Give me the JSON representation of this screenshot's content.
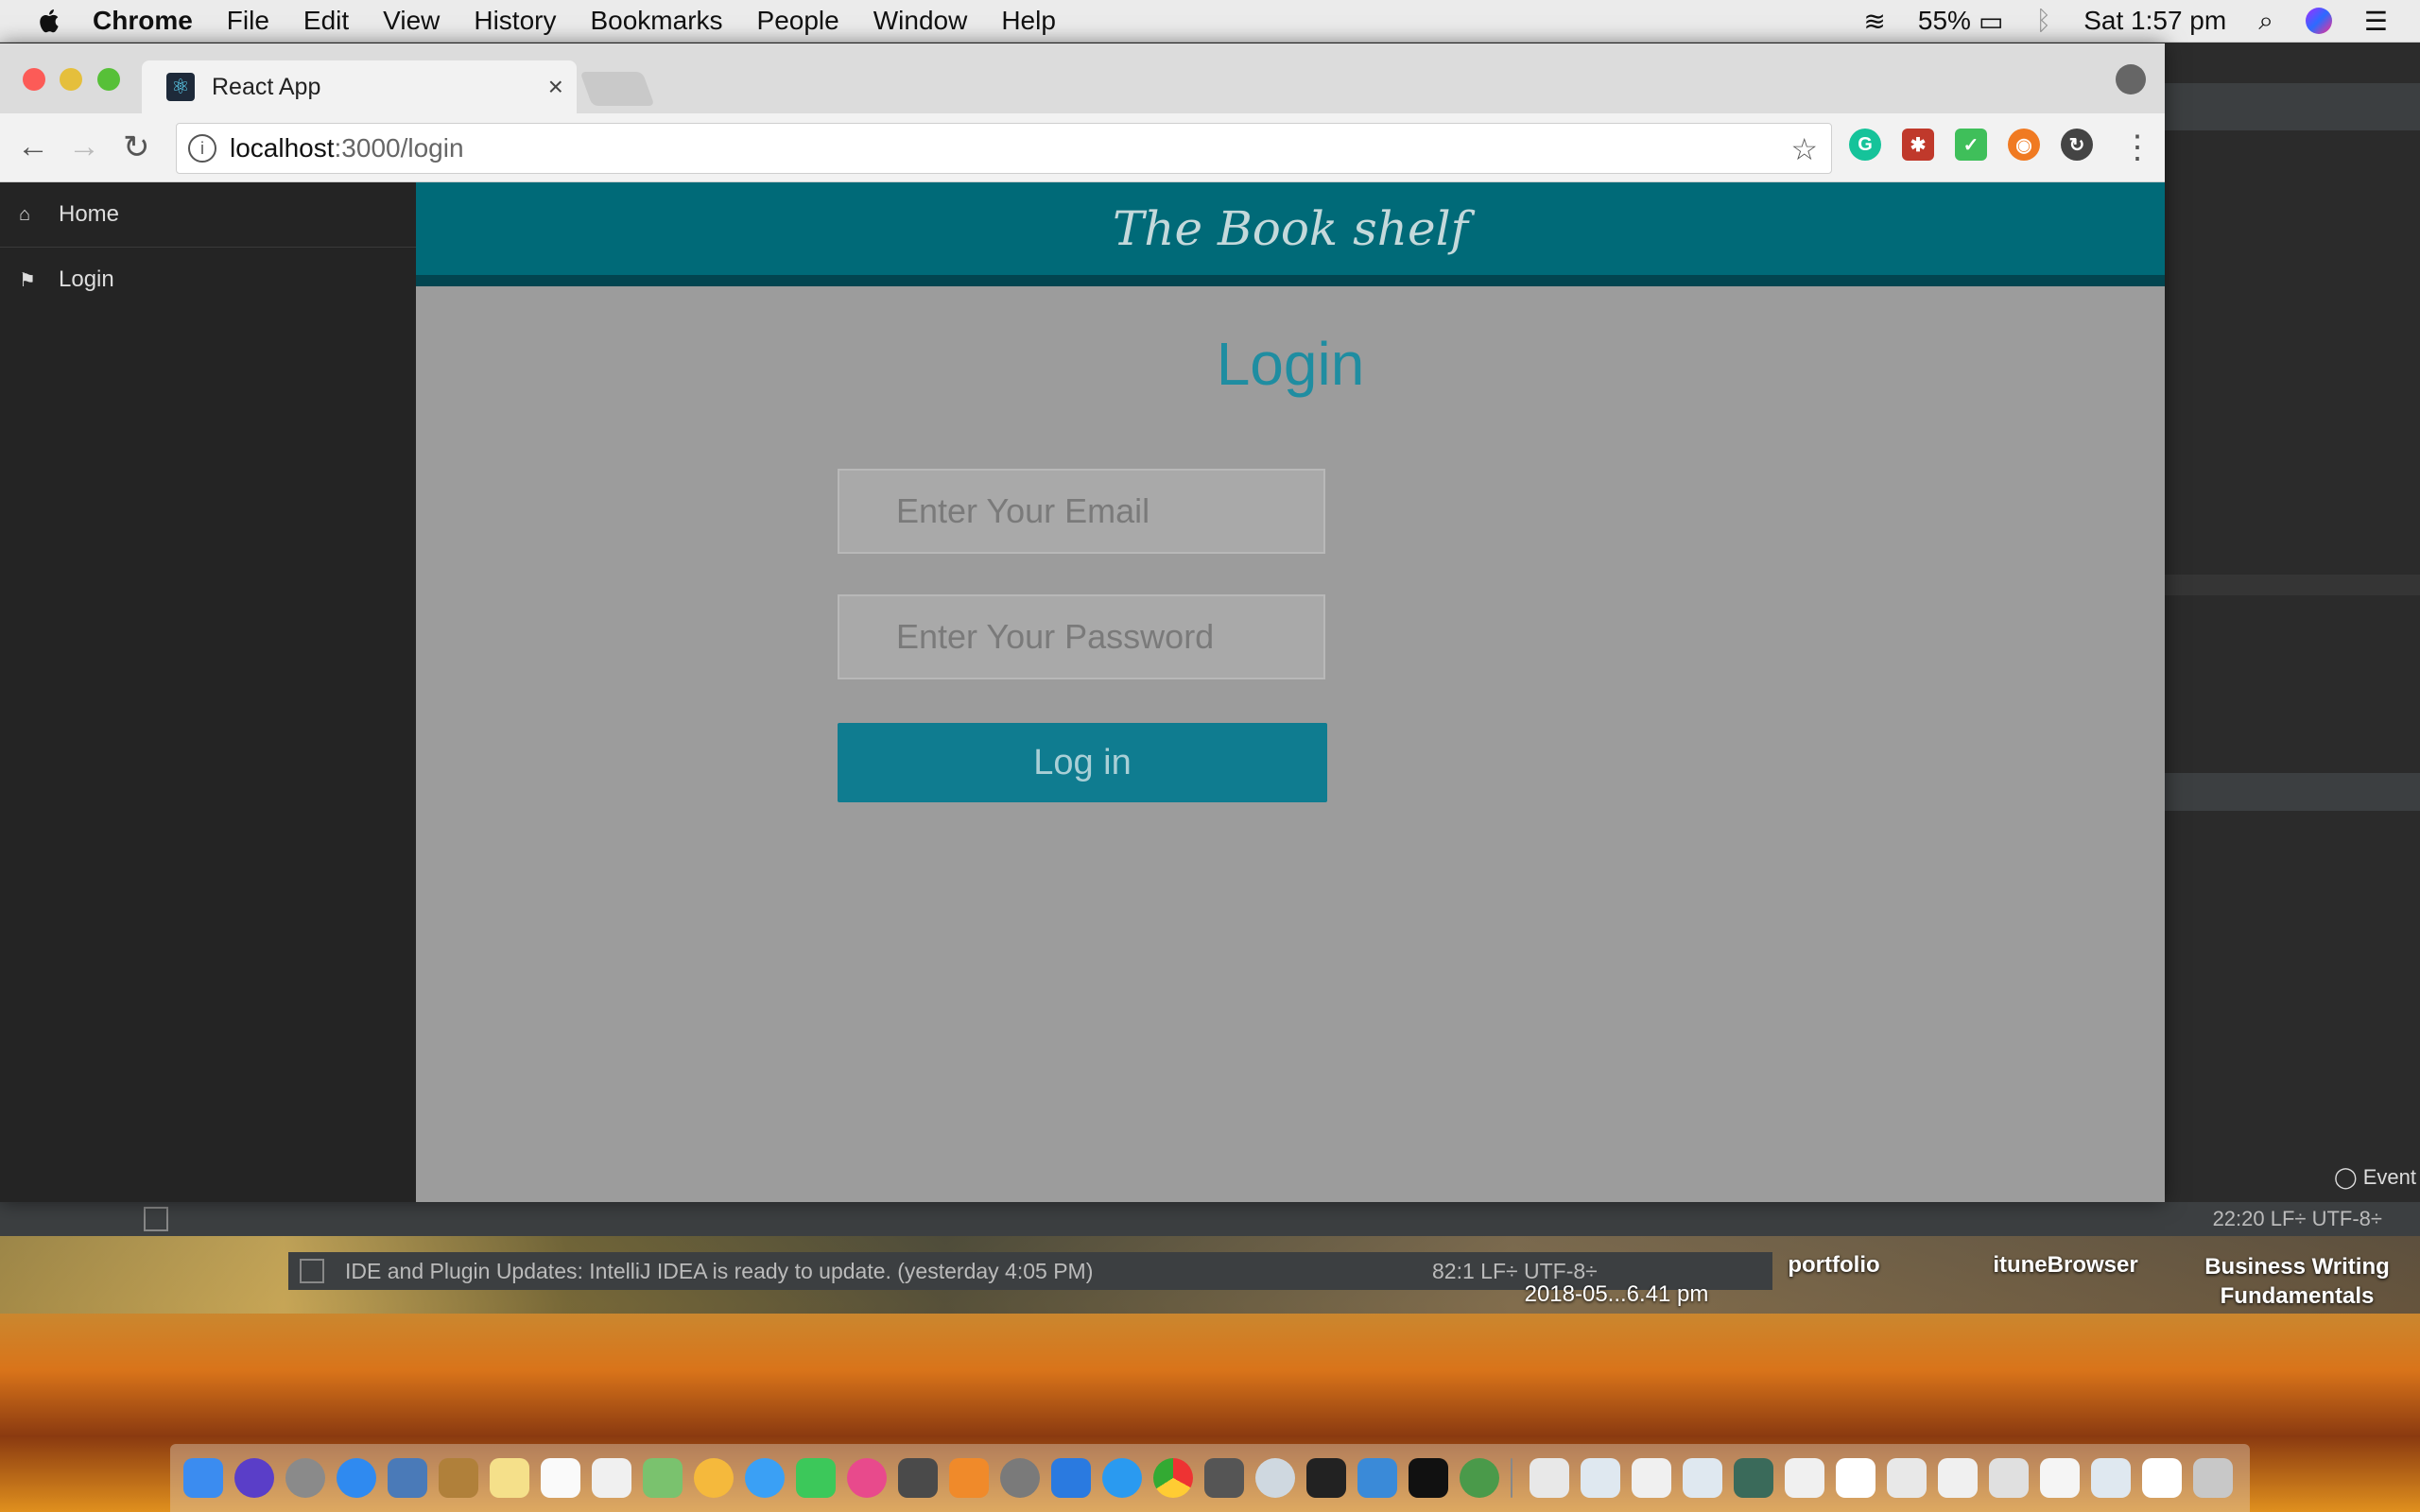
{
  "menubar": {
    "app": "Chrome",
    "items": [
      "File",
      "Edit",
      "View",
      "History",
      "Bookmarks",
      "People",
      "Window",
      "Help"
    ],
    "battery": "55%",
    "clock": "Sat 1:57 pm"
  },
  "browser": {
    "tab_title": "React App",
    "tab_close": "×",
    "url_host": "localhost",
    "url_path": ":3000/login"
  },
  "sidebar": {
    "items": [
      {
        "label": "Home",
        "icon": "home-icon"
      },
      {
        "label": "Login",
        "icon": "flag-icon"
      }
    ]
  },
  "header": {
    "title": "The Book shelf"
  },
  "login": {
    "title": "Login",
    "email_placeholder": "Enter Your Email",
    "password_placeholder": "Enter Your Password",
    "button": "Log in"
  },
  "ide": {
    "status_right": "22:20   LF÷   UTF-8÷",
    "event_label": "Event",
    "notification": "IDE and Plugin Updates: IntelliJ IDEA is ready to update. (yesterday 4:05 PM)",
    "notification_right": "82:1   LF÷   UTF-8÷"
  },
  "desktop": {
    "file_caption": "2018-05...6.41 pm",
    "folders": [
      "portfolio",
      "ituneBrowser",
      "Business Writing Fundamentals"
    ]
  },
  "colors": {
    "header_bg": "#006a78",
    "accent": "#1f8da1",
    "button_bg": "#0f7c90",
    "sidebar_bg": "#242424"
  }
}
